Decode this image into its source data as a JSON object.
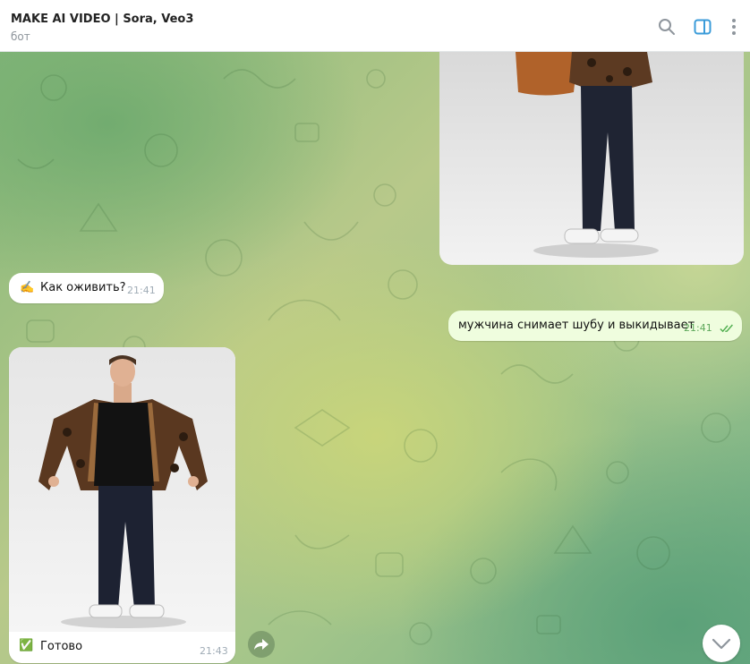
{
  "header": {
    "title": "MAKE AI VIDEO | Sora, Veo3",
    "subtitle": "бот",
    "icons": [
      "search-icon",
      "sidebar-toggle-icon",
      "more-vertical-icon"
    ],
    "accent": "#3a9bd9"
  },
  "messages": [
    {
      "type": "photo",
      "direction": "incoming-bot"
    },
    {
      "type": "text",
      "direction": "incoming",
      "emoji": "✍️",
      "text": "Как оживить?",
      "time": "21:41"
    },
    {
      "type": "text",
      "direction": "outgoing",
      "text": "мужчина снимает шубу и выкидывает",
      "time": "21:41",
      "status": "read"
    },
    {
      "type": "photo_caption",
      "direction": "incoming",
      "emoji": "✅",
      "caption": "Готово",
      "time": "21:43"
    }
  ],
  "colors": {
    "incoming_bubble": "#ffffff",
    "outgoing_bubble": "#effdde",
    "outgoing_time": "#5ea85b",
    "check_green": "#2db238"
  }
}
